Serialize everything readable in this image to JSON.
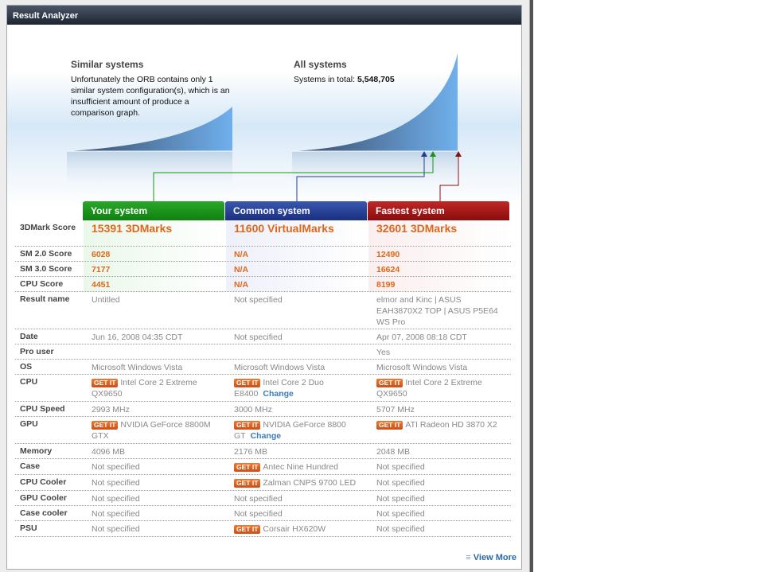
{
  "panel_title": "Result Analyzer",
  "similar": {
    "title": "Similar systems",
    "text": "Unfortunately the ORB contains only 1 similar system configuration(s), which is an insufficient amount of produce a comparison graph."
  },
  "all": {
    "title": "All systems",
    "total_label": "Systems in total:",
    "total": "5,548,705"
  },
  "columns": [
    {
      "label": "Your system",
      "color": "#169616"
    },
    {
      "label": "Common system",
      "color": "#233f90"
    },
    {
      "label": "Fastest system",
      "color": "#a01414"
    }
  ],
  "get_it": "GET IT",
  "change": "Change",
  "rows": [
    {
      "label": "3DMark Score",
      "vals": [
        "15391 3DMarks",
        "11600 VirtualMarks",
        "32601 3DMarks"
      ]
    },
    {
      "label": "SM 2.0 Score",
      "vals": [
        "6028",
        "N/A",
        "12490"
      ]
    },
    {
      "label": "SM 3.0 Score",
      "vals": [
        "7177",
        "N/A",
        "16624"
      ]
    },
    {
      "label": "CPU Score",
      "vals": [
        "4451",
        "N/A",
        "8199"
      ]
    },
    {
      "label": "Result name",
      "vals": [
        "Untitled",
        "Not specified",
        "elmor and Kinc | ASUS EAH3870X2 TOP | ASUS P5E64 WS Pro"
      ]
    },
    {
      "label": "Date",
      "vals": [
        "Jun 16, 2008 04:35 CDT",
        "Not specified",
        "Apr 07, 2008 08:18 CDT"
      ]
    },
    {
      "label": "Pro user",
      "vals": [
        "",
        "",
        "Yes"
      ]
    },
    {
      "label": "OS",
      "vals": [
        "Microsoft Windows Vista",
        "Microsoft Windows Vista",
        "Microsoft Windows Vista"
      ]
    },
    {
      "label": "CPU",
      "vals": [
        "Intel Core 2 Extreme QX9650",
        "Intel Core 2 Duo E8400",
        "Intel Core 2 Extreme QX9650"
      ]
    },
    {
      "label": "CPU Speed",
      "vals": [
        "2993 MHz",
        "3000 MHz",
        "5707 MHz"
      ]
    },
    {
      "label": "GPU",
      "vals": [
        "NVIDIA GeForce 8800M GTX",
        "NVIDIA GeForce 8800 GT",
        "ATI Radeon HD 3870 X2"
      ]
    },
    {
      "label": "Memory",
      "vals": [
        "4096 MB",
        "2176 MB",
        "2048 MB"
      ]
    },
    {
      "label": "Case",
      "vals": [
        "Not specified",
        "Antec Nine Hundred",
        "Not specified"
      ]
    },
    {
      "label": "CPU Cooler",
      "vals": [
        "Not specified",
        "Zalman CNPS 9700 LED",
        "Not specified"
      ]
    },
    {
      "label": "GPU Cooler",
      "vals": [
        "Not specified",
        "Not specified",
        "Not specified"
      ]
    },
    {
      "label": "Case cooler",
      "vals": [
        "Not specified",
        "Not specified",
        "Not specified"
      ]
    },
    {
      "label": "PSU",
      "vals": [
        "Not specified",
        "Corsair HX620W",
        "Not specified"
      ]
    }
  ],
  "view_more": "View More"
}
